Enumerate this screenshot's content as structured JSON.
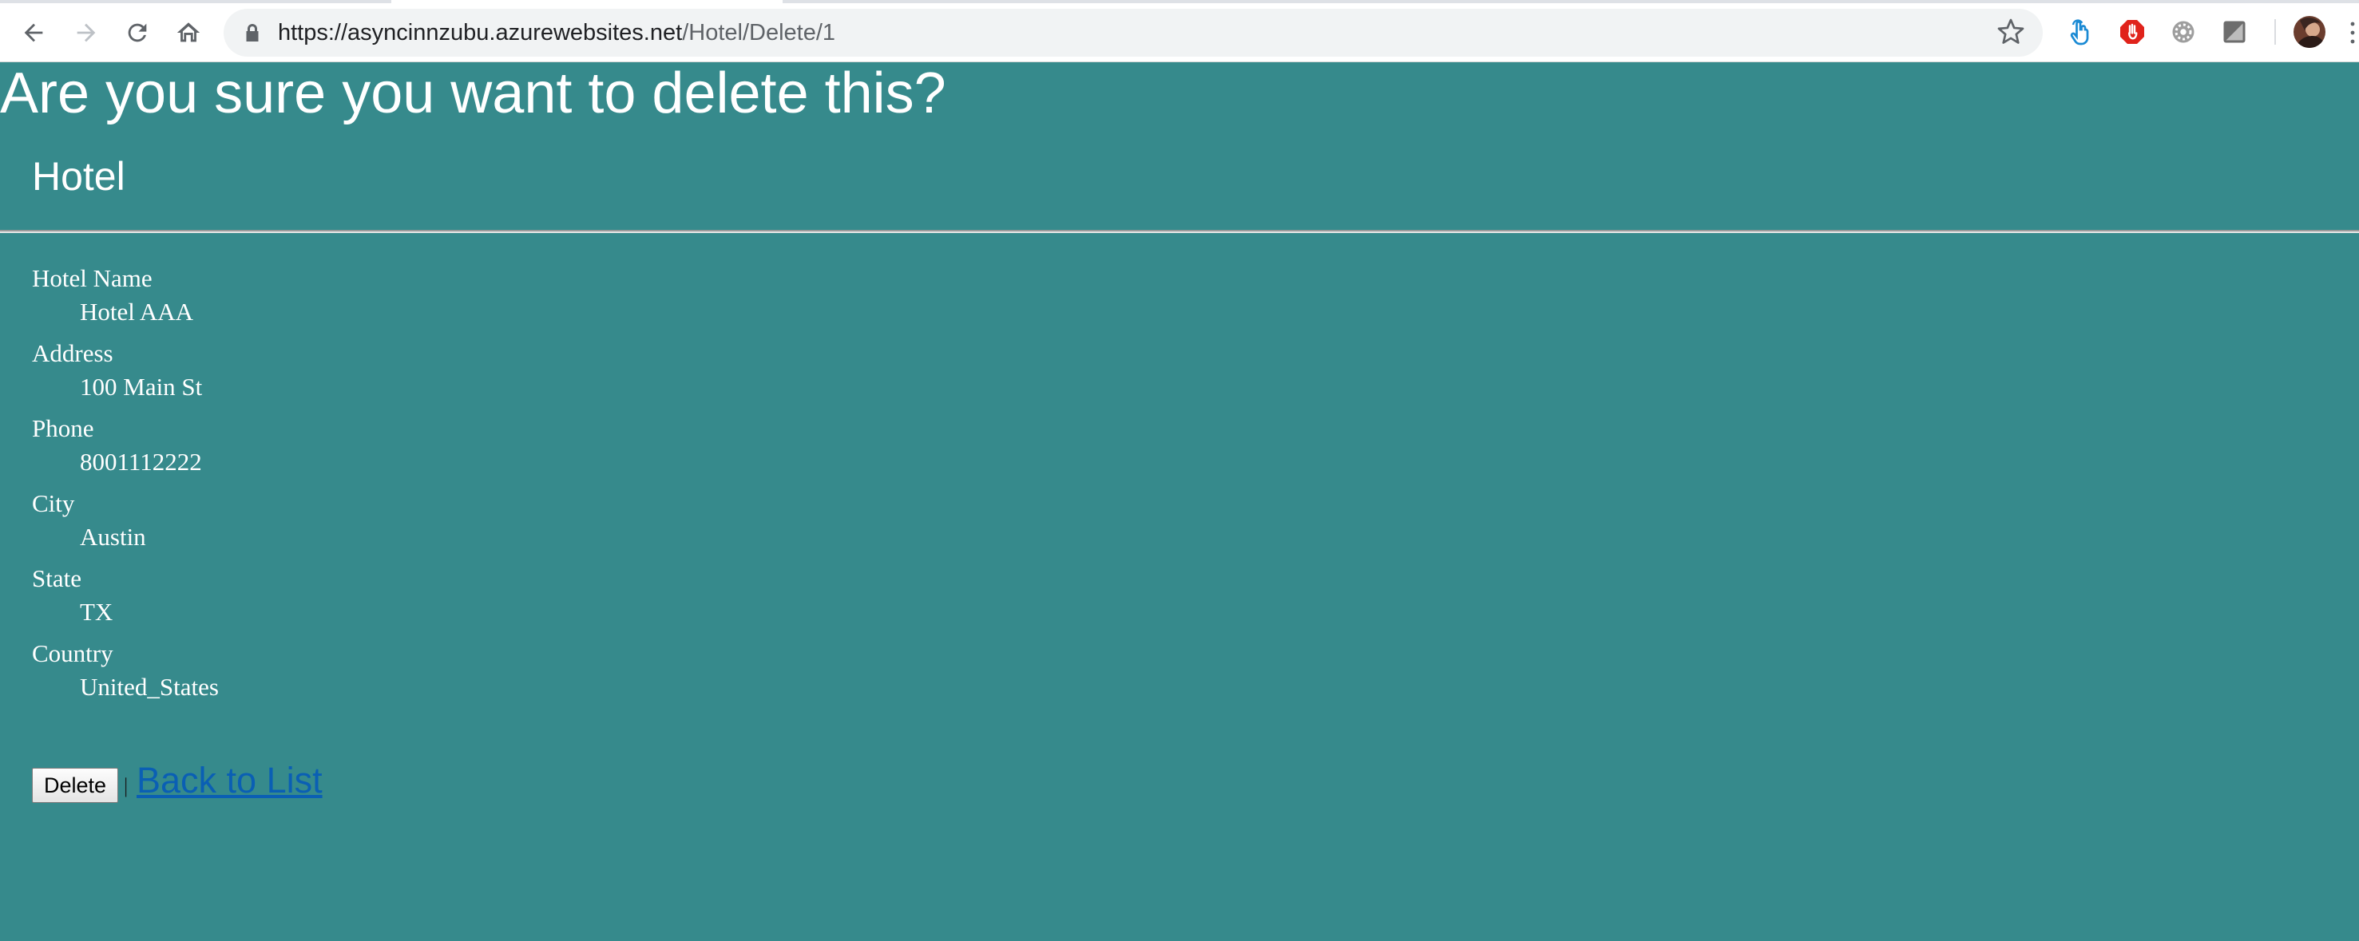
{
  "browser": {
    "url_host": "https://asyncinnzubu.azurewebsites.net",
    "url_path": "/Hotel/Delete/1",
    "icons": {
      "back": "arrow-left-icon",
      "forward": "arrow-right-icon",
      "reload": "reload-icon",
      "home": "home-icon",
      "lock": "lock-icon",
      "bookmark": "star-icon",
      "menu": "kebab-menu-icon"
    },
    "extensions": [
      "touch-hand-extension-icon",
      "stop-hand-extension-icon",
      "gear-extension-icon",
      "slash-extension-icon"
    ]
  },
  "page": {
    "title": "Are you sure you want to delete this?",
    "section_title": "Hotel",
    "fields": [
      {
        "label": "Hotel Name",
        "value": "Hotel AAA"
      },
      {
        "label": "Address",
        "value": "100 Main St"
      },
      {
        "label": "Phone",
        "value": "8001112222"
      },
      {
        "label": "City",
        "value": "Austin"
      },
      {
        "label": "State",
        "value": "TX"
      },
      {
        "label": "Country",
        "value": "United_States"
      }
    ],
    "delete_label": "Delete",
    "separator": "|",
    "back_link": "Back to List"
  },
  "colors": {
    "page_background": "#368a8c",
    "text": "#ffffff",
    "link": "#0a5fb4"
  }
}
